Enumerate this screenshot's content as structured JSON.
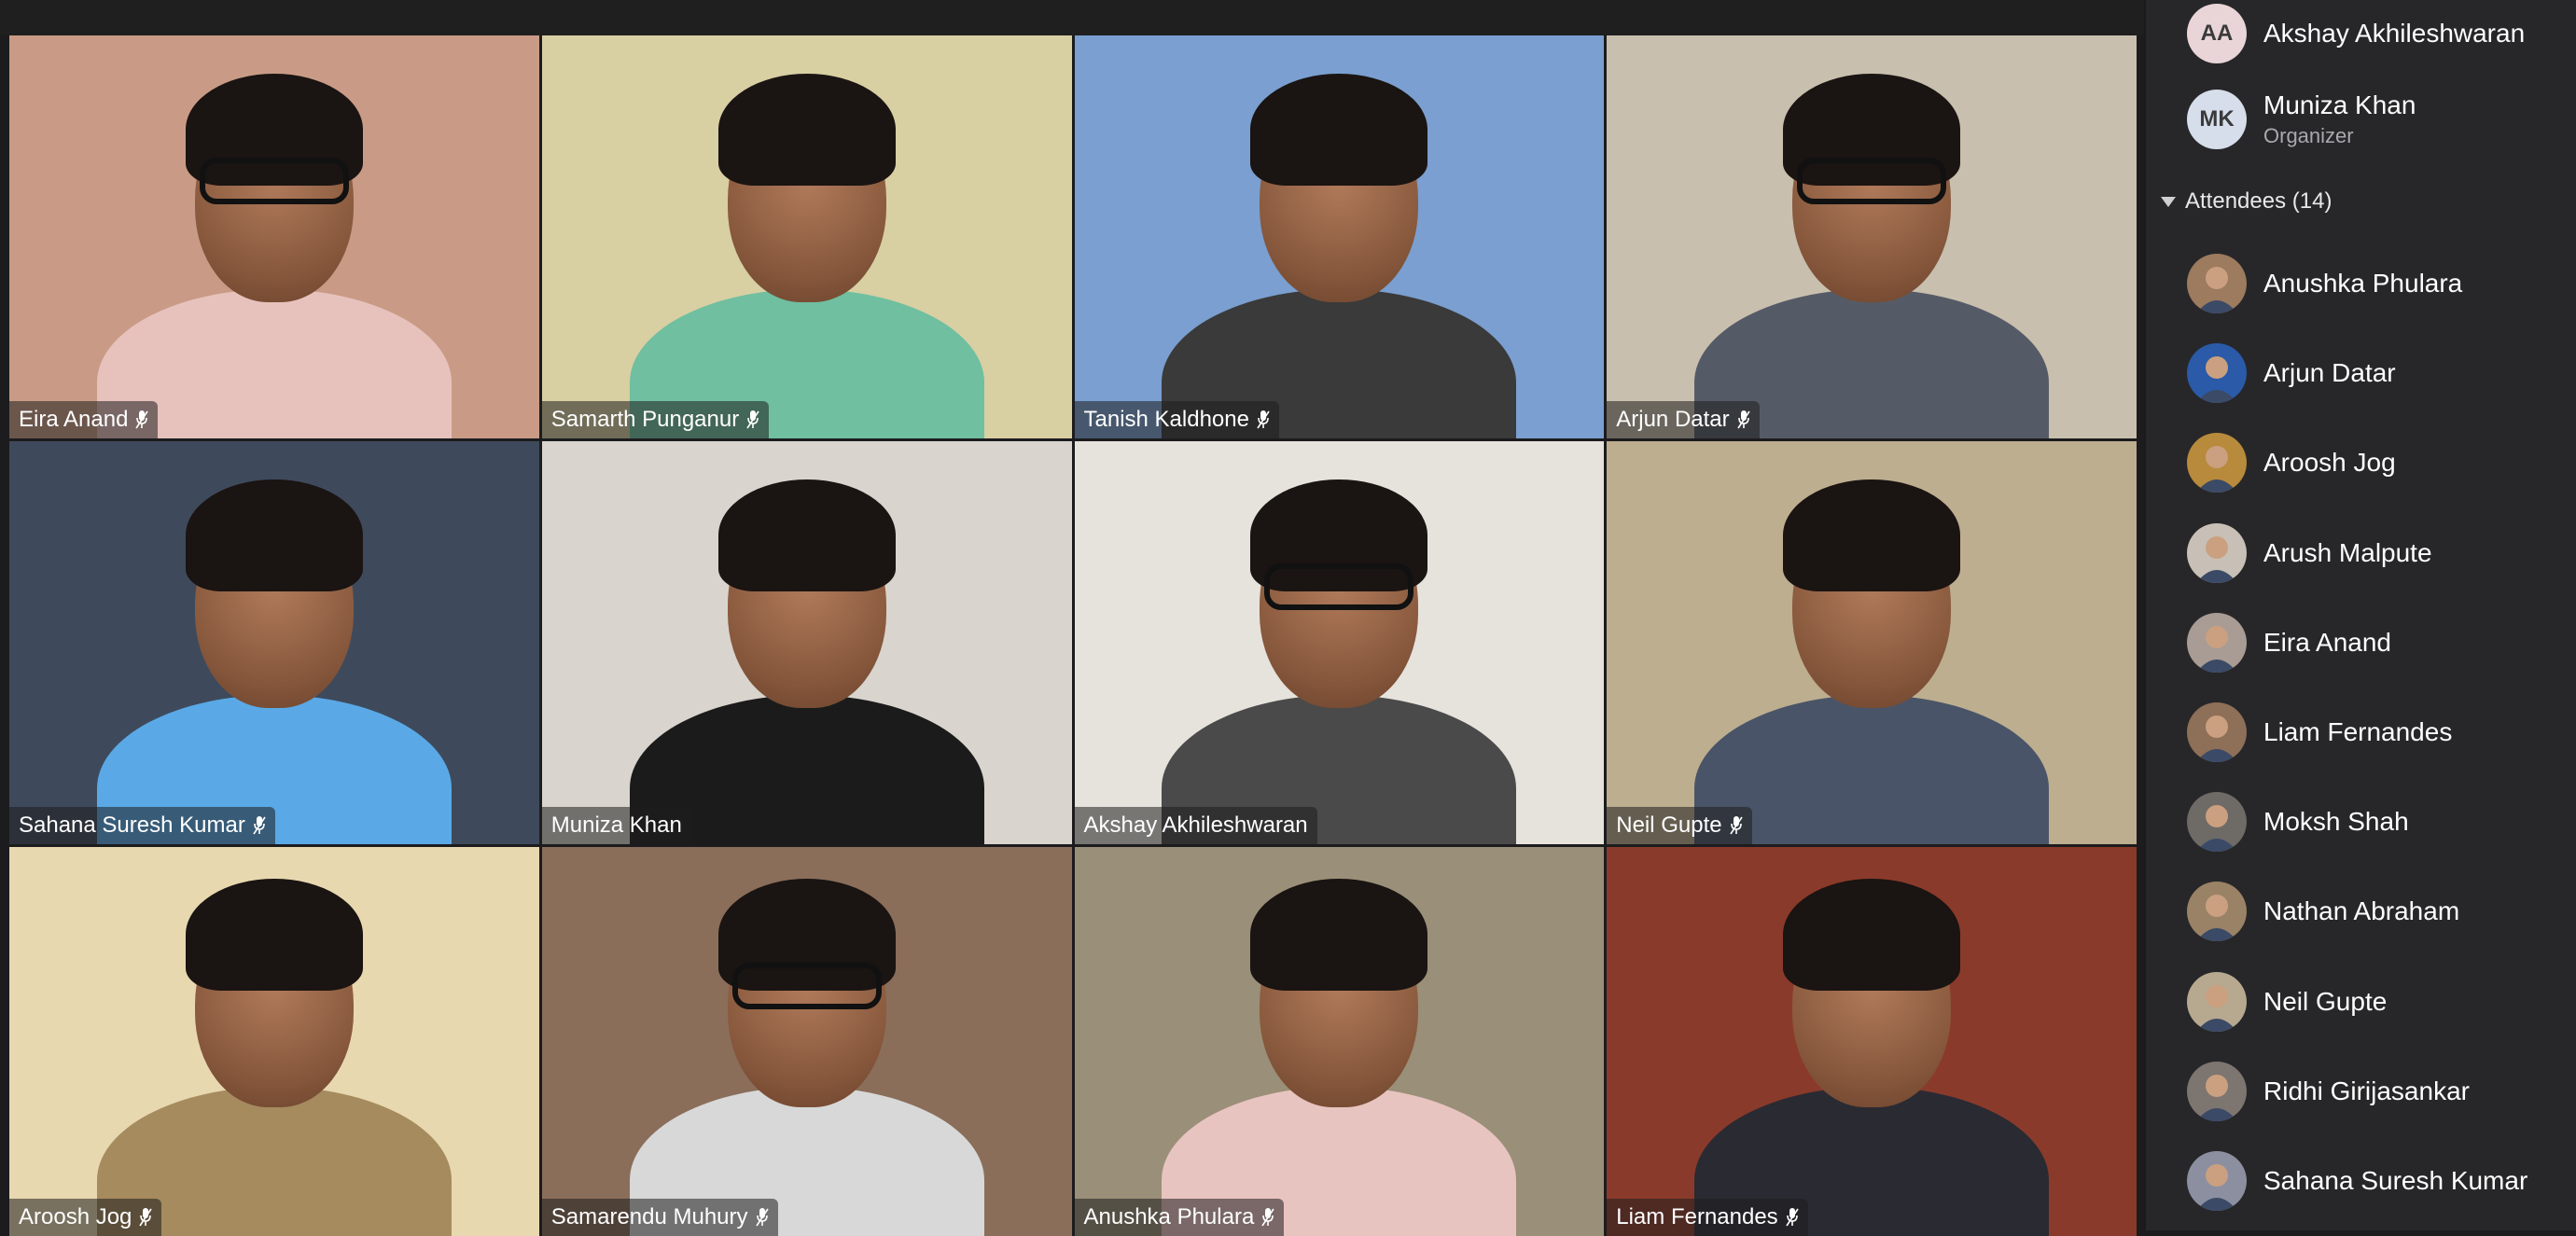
{
  "video_grid": {
    "tiles": [
      {
        "name": "Eira Anand",
        "muted": true,
        "bg": "#c99b86",
        "shirt": "#e7c2bd"
      },
      {
        "name": "Samarth Punganur",
        "muted": true,
        "bg": "#d8cfa3",
        "shirt": "#6fbfa0"
      },
      {
        "name": "Tanish Kaldhone",
        "muted": true,
        "bg": "#7a9fd0",
        "shirt": "#3a3a3a"
      },
      {
        "name": "Arjun Datar",
        "muted": true,
        "bg": "#c8bfae",
        "shirt": "#555b66"
      },
      {
        "name": "Sahana Suresh Kumar",
        "muted": true,
        "bg": "#3e4a5c",
        "shirt": "#5aa9e6"
      },
      {
        "name": "Muniza Khan",
        "muted": false,
        "bg": "#d9d4cd",
        "shirt": "#1b1b1b"
      },
      {
        "name": "Akshay Akhileshwaran",
        "muted": false,
        "bg": "#e6e2dc",
        "shirt": "#4a4a4a"
      },
      {
        "name": "Neil Gupte",
        "muted": true,
        "bg": "#bcae8f",
        "shirt": "#4a5468"
      },
      {
        "name": "Aroosh Jog",
        "muted": true,
        "bg": "#e8d8b0",
        "shirt": "#a58b5e"
      },
      {
        "name": "Samarendu Muhury",
        "muted": true,
        "bg": "#8a6e5a",
        "shirt": "#d8d8d8"
      },
      {
        "name": "Anushka Phulara",
        "muted": true,
        "bg": "#9a8f78",
        "shirt": "#e8c4c0"
      },
      {
        "name": "Liam Fernandes",
        "muted": true,
        "bg": "#8a3a2a",
        "shirt": "#2a2a33"
      }
    ]
  },
  "participants": {
    "organizers": [
      {
        "initials": "AA",
        "name": "Akshay Akhileshwaran",
        "role": "",
        "avatar_color": "#e9d5d7"
      },
      {
        "initials": "MK",
        "name": "Muniza Khan",
        "role": "Organizer",
        "avatar_color": "#d6ddeb"
      }
    ],
    "attendees_header": "Attendees (14)",
    "attendees": [
      {
        "name": "Anushka Phulara",
        "avatar_color": "#9c7b5e"
      },
      {
        "name": "Arjun Datar",
        "avatar_color": "#2a5aa8"
      },
      {
        "name": "Aroosh Jog",
        "avatar_color": "#b88a3c"
      },
      {
        "name": "Arush Malpute",
        "avatar_color": "#c8c0b6"
      },
      {
        "name": "Eira Anand",
        "avatar_color": "#a89c94"
      },
      {
        "name": "Liam Fernandes",
        "avatar_color": "#8e6f58"
      },
      {
        "name": "Moksh Shah",
        "avatar_color": "#6e6a66"
      },
      {
        "name": "Nathan Abraham",
        "avatar_color": "#9a8266"
      },
      {
        "name": "Neil Gupte",
        "avatar_color": "#b7a98f"
      },
      {
        "name": "Ridhi Girijasankar",
        "avatar_color": "#7d7570"
      },
      {
        "name": "Sahana Suresh Kumar",
        "avatar_color": "#8c8fa0"
      }
    ]
  }
}
